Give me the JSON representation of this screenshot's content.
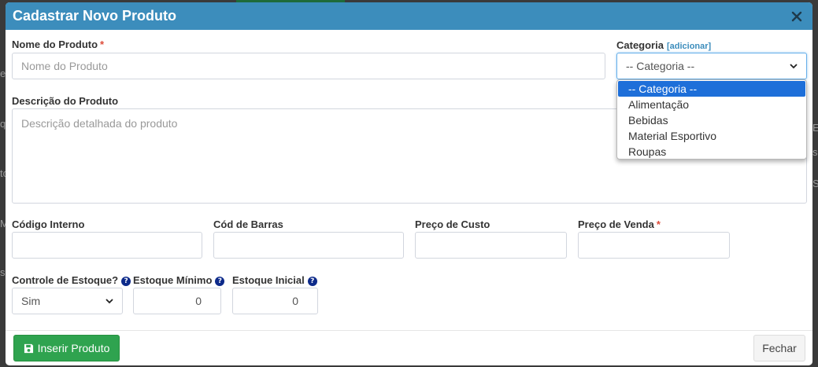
{
  "backdrop": {
    "fragments": [
      "e",
      "q",
      "to",
      "M",
      "s",
      "Es",
      "s",
      "S"
    ]
  },
  "modal": {
    "title": "Cadastrar Novo Produto"
  },
  "form": {
    "nome": {
      "label": "Nome do Produto",
      "required": "*",
      "placeholder": "Nome do Produto"
    },
    "categoria": {
      "label": "Categoria",
      "add_link": "[adicionar]",
      "selected": "-- Categoria --",
      "options": [
        "-- Categoria --",
        "Alimentação",
        "Bebidas",
        "Material Esportivo",
        "Roupas"
      ]
    },
    "descricao": {
      "label": "Descrição do Produto",
      "placeholder": "Descrição detalhada do produto"
    },
    "codigo_interno": {
      "label": "Código Interno",
      "value": ""
    },
    "cod_barras": {
      "label": "Cód de Barras",
      "value": ""
    },
    "preco_custo": {
      "label": "Preço de Custo",
      "value": ""
    },
    "preco_venda": {
      "label": "Preço de Venda",
      "required": "*",
      "value": ""
    },
    "controle_estoque": {
      "label": "Controle de Estoque?",
      "help": "?",
      "selected": "Sim"
    },
    "estoque_minimo": {
      "label": "Estoque Mínimo",
      "help": "?",
      "value": "0"
    },
    "estoque_inicial": {
      "label": "Estoque Inicial",
      "help": "?",
      "value": "0"
    }
  },
  "footer": {
    "insert_label": "Inserir Produto",
    "close_label": "Fechar"
  },
  "colors": {
    "header": "#3c8dbc",
    "insert_button": "#2fa34f",
    "required": "#dd4b39",
    "selected_option": "#1e6fd9"
  },
  "icons": {
    "close": "close-icon",
    "save": "floppy-disk-icon",
    "help": "question-circle-icon",
    "select": "chevron-down-icon"
  }
}
